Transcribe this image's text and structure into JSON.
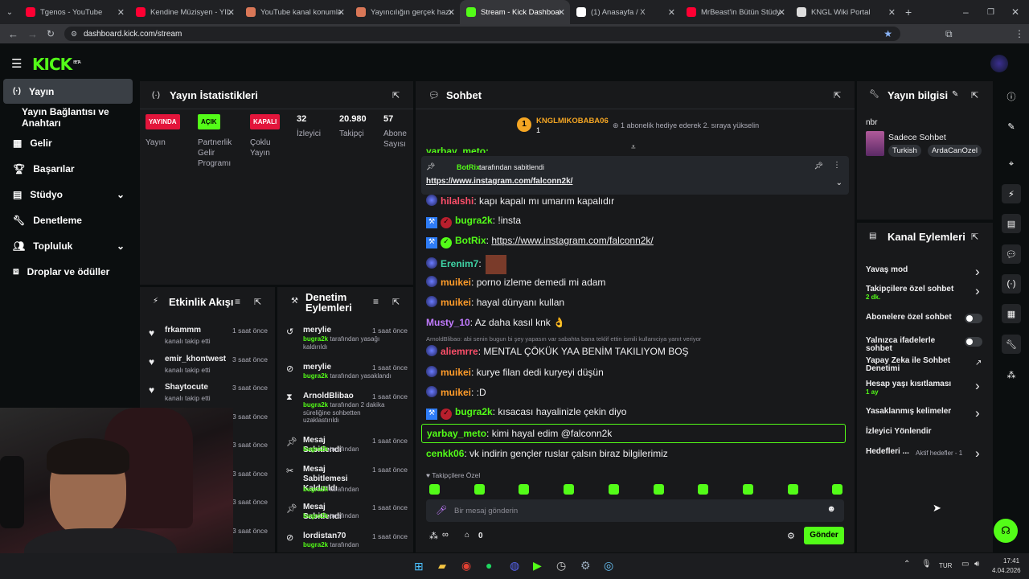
{
  "browser": {
    "tabs": [
      {
        "title": "Tgenos - YouTube",
        "color": "#ff0033"
      },
      {
        "title": "Kendine Müzisyen - YILLA",
        "color": "#ff0033"
      },
      {
        "title": "YouTube kanal konumları",
        "color": "#d97757"
      },
      {
        "title": "Yayıncılığın gerçek hazırlı",
        "color": "#d97757"
      },
      {
        "title": "Stream - Kick Dashboard",
        "color": "#53fc18"
      },
      {
        "title": "(1) Anasayfa / X",
        "color": "#ffffff"
      },
      {
        "title": "MrBeast'in Bütün Stüdyol",
        "color": "#ff0033"
      },
      {
        "title": "KNGL Wiki Portal",
        "color": "#dddddd"
      }
    ],
    "url": "dashboard.kick.com/stream"
  },
  "logo": {
    "text": "KICK",
    "beta": "BETA"
  },
  "sidebar": {
    "items": [
      {
        "label": "Yayın",
        "icon": "broadcast-icon"
      },
      {
        "label": "Yayın Bağlantısı ve Anahtarı",
        "icon": ""
      },
      {
        "label": "Gelir",
        "icon": "grid-icon"
      },
      {
        "label": "Başarılar",
        "icon": "trophy-icon"
      },
      {
        "label": "Stüdyo",
        "icon": "studio-icon"
      },
      {
        "label": "Denetleme",
        "icon": "wrench-icon"
      },
      {
        "label": "Topluluk",
        "icon": "community-icon"
      },
      {
        "label": "Droplar ve ödüller",
        "icon": "drops-icon"
      }
    ]
  },
  "stats": {
    "title": "Yayın İstatistikleri",
    "items": [
      {
        "badge": "YAYINDA",
        "label": "Yayın"
      },
      {
        "badge": "AÇIK",
        "label": "Partnerlik Gelir Programı"
      },
      {
        "badge": "KAPALI",
        "label": "Çoklu Yayın"
      },
      {
        "value": "32",
        "label": "İzleyici"
      },
      {
        "value": "20.980",
        "label": "Takipçi"
      },
      {
        "value": "57",
        "label": "Abone Sayısı"
      }
    ]
  },
  "activity": {
    "title": "Etkinlik Akışı",
    "items": [
      {
        "name": "frkammm",
        "time": "1 saat önce",
        "desc": "kanalı takip etti"
      },
      {
        "name": "emir_khontwest",
        "time": "3 saat önce",
        "desc": "kanalı takip etti"
      },
      {
        "name": "Shaytocute",
        "time": "3 saat önce",
        "desc": "kanalı takip etti"
      },
      {
        "name": "",
        "time": "3 saat önce",
        "desc": ""
      },
      {
        "name": "",
        "time": "3 saat önce",
        "desc": ""
      },
      {
        "name": "",
        "time": "3 saat önce",
        "desc": ""
      },
      {
        "name": "",
        "time": "3 saat önce",
        "desc": ""
      },
      {
        "name": "",
        "time": "3 saat önce",
        "desc": ""
      }
    ]
  },
  "moderation": {
    "title": "Denetim Eylemleri",
    "items": [
      {
        "name": "merylie",
        "time": "1 saat önce",
        "actor": "bugra2k",
        "desc": "tarafından yasağı kaldırıldı"
      },
      {
        "name": "merylie",
        "time": "1 saat önce",
        "actor": "bugra2k",
        "desc": "tarafından yasaklandı"
      },
      {
        "name": "ArnoldBlibao",
        "time": "1 saat önce",
        "actor": "bugra2k",
        "desc": "tarafından 2 dakika süreliğine sohbetten uzaklaştırıldı"
      },
      {
        "name": "Mesaj Sabitlendi",
        "time": "1 saat önce",
        "actor": "bugra2k",
        "desc": "tarafından"
      },
      {
        "name": "Mesaj Sabitlemesi Kaldırıldı",
        "time": "1 saat önce",
        "actor": "bugra2k",
        "desc": "tarafından"
      },
      {
        "name": "Mesaj Sabitlendi",
        "time": "1 saat önce",
        "actor": "bugra2k",
        "desc": "tarafından"
      },
      {
        "name": "lordistan70",
        "time": "1 saat önce",
        "actor": "bugra2k",
        "desc": "tarafından"
      }
    ]
  },
  "chat": {
    "title": "Sohbet",
    "gift": {
      "user": "KNGLMIKOBABA06",
      "count": "1",
      "text": "1 abonelik hediye ederek 2. sıraya yükselin"
    },
    "top_partial": "yarbay_meto:",
    "pinned": {
      "by": "BotRix",
      "suffix": "tarafından sabitlendi",
      "link": "https://www.instagram.com/falconn2k/"
    },
    "messages": [
      {
        "user": "hilalshi",
        "color": "#ff4f6a",
        "text": "kapı kapalı mı umarım kapalıdır"
      },
      {
        "user": "bugra2k",
        "color": "#53fc18",
        "text": "!insta"
      },
      {
        "user": "BotRix",
        "color": "#53fc18",
        "text": "https://www.instagram.com/falconn2k/"
      },
      {
        "user": "Erenim7",
        "color": "#3fd4a6",
        "text": ""
      },
      {
        "user": "muikei",
        "color": "#ff9c2a",
        "text": "porno izleme demedi mi adam"
      },
      {
        "user": "muikei",
        "color": "#ff9c2a",
        "text": "hayal dünyanı kullan"
      },
      {
        "user": "Musty_10",
        "color": "#c27bff",
        "text": "Az daha kasıl knk 👌"
      },
      {
        "user": "aliemrre",
        "color": "#ff4f6a",
        "text": "MENTAL ÇÖKÜK YAA BENİM TAKILIYOM BOŞ"
      },
      {
        "user": "muikei",
        "color": "#ff9c2a",
        "text": "kurye filan dedi kuryeyi düşün"
      },
      {
        "user": "muikei",
        "color": "#ff9c2a",
        "text": ":D"
      },
      {
        "user": "bugra2k",
        "color": "#53fc18",
        "text": "kısacası hayalinizle çekin diyo"
      },
      {
        "user": "yarbay_meto",
        "color": "#53fc18",
        "text": "kimi hayal edim @falconn2k"
      },
      {
        "user": "cenkk06",
        "color": "#53fc18",
        "text": "vk indirin gençler ruslar çalsın biraz bilgilerimiz"
      }
    ],
    "reply_note": "ArnoldBlibao: abi senin bugun bi şey yapasın var sabahta bana teklif ettin ismili kullanıciya yanıt veriyor",
    "followers_only": "Takipçilere Özel",
    "input_placeholder": "Bir mesaj gönderin",
    "points": "0",
    "send_label": "Gönder"
  },
  "stream_info": {
    "title": "Yayın bilgisi",
    "name": "nbr",
    "category": "Sadece Sohbet",
    "tags": [
      "Turkish",
      "ArdaCanOzel"
    ]
  },
  "channel_actions": {
    "title": "Kanal Eylemleri",
    "items": [
      {
        "label": "Yavaş mod",
        "sub": "",
        "type": "chevron"
      },
      {
        "label": "Takipçilere özel sohbet",
        "sub": "2 dk.",
        "type": "chevron"
      },
      {
        "label": "Abonelere özel sohbet",
        "sub": "",
        "type": "toggle"
      },
      {
        "label": "Yalnızca ifadelerle sohbet",
        "sub": "",
        "type": "toggle"
      },
      {
        "label": "Yapay Zeka ile Sohbet Denetimi",
        "sub": "",
        "type": "external"
      },
      {
        "label": "Hesap yaşı kısıtlaması",
        "sub": "1 ay",
        "type": "chevron"
      },
      {
        "label": "Yasaklanmış kelimeler",
        "sub": "",
        "type": "chevron"
      },
      {
        "label": "İzleyici Yönlendir",
        "sub": "",
        "type": "none"
      },
      {
        "label": "Hedefleri ...",
        "sub": "Aktif hedefler - 1",
        "type": "chevron"
      }
    ]
  },
  "taskbar": {
    "lang": "TUR",
    "time": "17:41",
    "date": "4.04.2026"
  },
  "colors": {
    "accent": "#53fc18",
    "panel": "#18191b",
    "bg": "#0b0e0f"
  }
}
